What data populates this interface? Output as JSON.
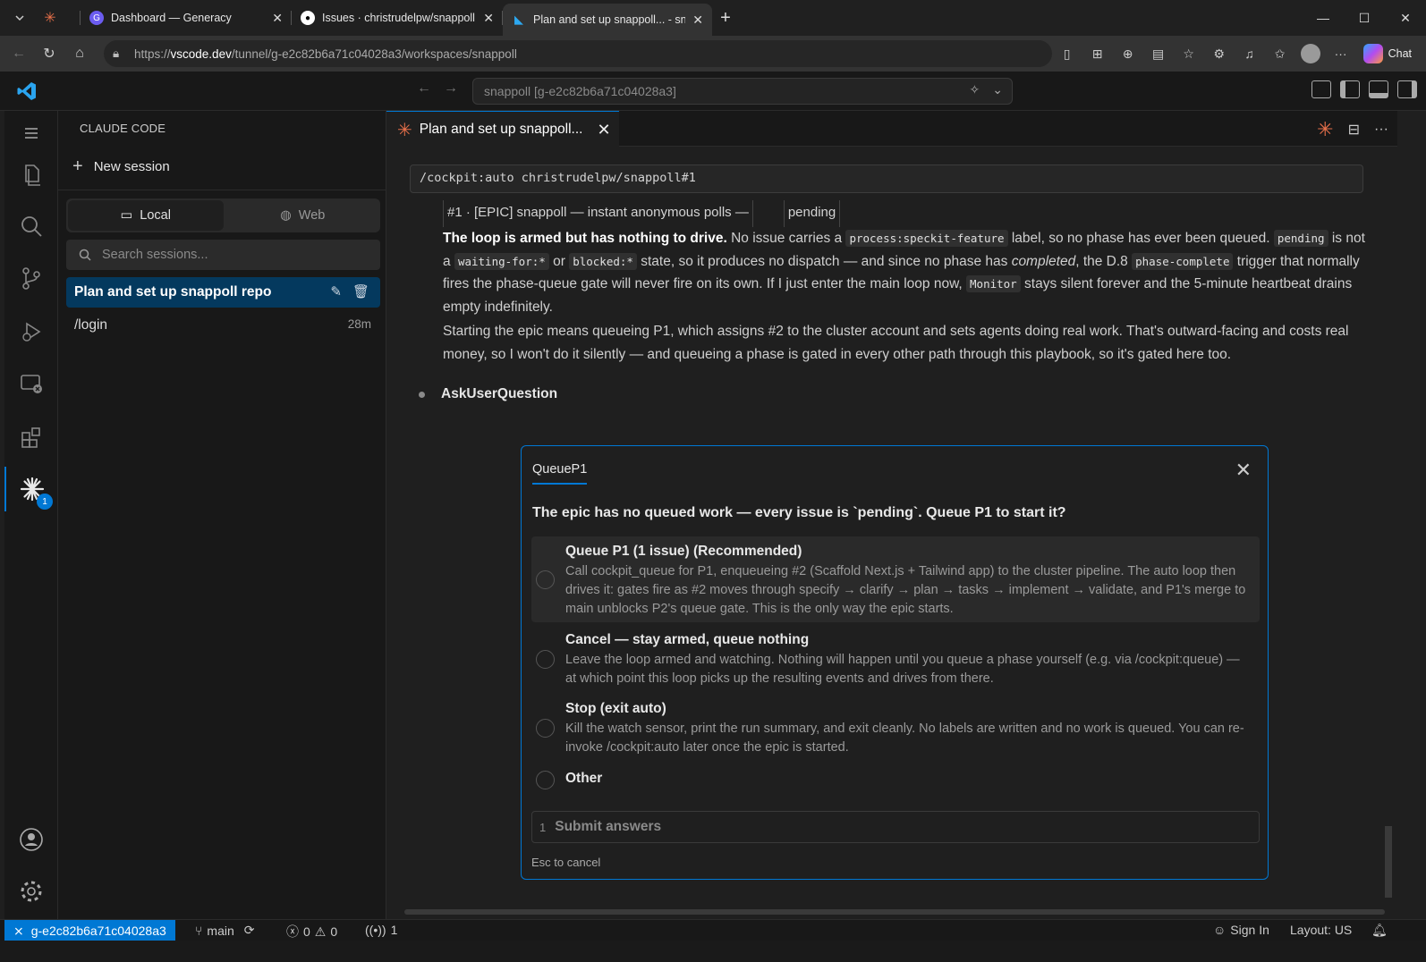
{
  "browser": {
    "tabs": [
      {
        "title": "",
        "favicon": "claude-asterisk-icon"
      },
      {
        "title": "Dashboard — Generacy",
        "favicon": "generacy-icon"
      },
      {
        "title": "Issues · christrudelpw/snappoll",
        "favicon": "github-icon"
      },
      {
        "title": "Plan and set up snappoll... - snapp",
        "favicon": "vscode-icon",
        "active": true
      }
    ],
    "url_host": "vscode.dev",
    "url_prefix": "https://",
    "url_path": "/tunnel/g-e2c82b6a71c04028a3/workspaces/snappoll",
    "chat_label": "Chat"
  },
  "titlebar": {
    "command_center": "snappoll [g-e2c82b6a71c04028a3]"
  },
  "sidebar": {
    "title": "CLAUDE CODE",
    "new_session": "New session",
    "segments": [
      {
        "label": "Local",
        "active": true
      },
      {
        "label": "Web",
        "active": false
      }
    ],
    "search_placeholder": "Search sessions...",
    "sessions": [
      {
        "label": "Plan and set up snappoll repo",
        "active": true
      },
      {
        "label": "/login",
        "time": "28m"
      }
    ]
  },
  "activity": {
    "badge": "1"
  },
  "editor": {
    "tab_title": "Plan and set up snappoll...",
    "command": "/cockpit:auto christrudelpw/snappoll#1",
    "issue_cells": [
      "#1 · [EPIC] snappoll — instant anonymous polls —",
      "pending"
    ],
    "msg": {
      "p1_bold": "The loop is armed but has nothing to drive.",
      "p1_a": " No issue carries a ",
      "p1_code1": "process:speckit-feature",
      "p1_b": " label, so no phase has ever been queued. ",
      "p1_code2": "pending",
      "p1_c": " is not a ",
      "p1_code3": "waiting-for:*",
      "p1_d": " or ",
      "p1_code4": "blocked:*",
      "p1_e": " state, so it produces no dispatch — and since no phase has ",
      "p1_em": "completed",
      "p1_f": ", the D.8 ",
      "p1_code5": "phase-complete",
      "p1_g": " trigger that normally fires the phase-queue gate will never fire on its own. If I just enter the main loop now, ",
      "p1_code6": "Monitor",
      "p1_h": " stays silent forever and the 5-minute heartbeat drains empty indefinitely.",
      "p2": "Starting the epic means queueing P1, which assigns #2 to the cluster account and sets agents doing real work. That's outward-facing and costs real money, so I won't do it silently — and queueing a phase is gated in every other path through this playbook, so it's gated here too."
    },
    "tool_name": "AskUserQuestion"
  },
  "question": {
    "tab": "QueueP1",
    "text": "The epic has no queued work — every issue is `pending`. Queue P1 to start it?",
    "options": [
      {
        "label": "Queue P1 (1 issue) (Recommended)",
        "desc": "Call cockpit_queue for P1, enqueueing #2 (Scaffold Next.js + Tailwind app) to the cluster pipeline. The auto loop then drives it: gates fire as #2 moves through specify → clarify → plan → tasks → implement → validate, and P1's merge to main unblocks P2's queue gate. This is the only way the epic starts."
      },
      {
        "label": "Cancel — stay armed, queue nothing",
        "desc": "Leave the loop armed and watching. Nothing will happen until you queue a phase yourself (e.g. via /cockpit:queue) — at which point this loop picks up the resulting events and drives from there."
      },
      {
        "label": "Stop (exit auto)",
        "desc": "Kill the watch sensor, print the run summary, and exit cleanly. No labels are written and no work is queued. You can re-invoke /cockpit:auto later once the epic is started."
      },
      {
        "label": "Other",
        "desc": ""
      }
    ],
    "submit_num": "1",
    "submit": "Submit answers",
    "esc_hint": "Esc to cancel"
  },
  "statusbar": {
    "remote": "g-e2c82b6a71c04028a3",
    "branch": "main",
    "errors": "0",
    "warnings": "0",
    "ports": "1",
    "sign_in": "Sign In",
    "layout": "Layout: US"
  },
  "colors": {
    "accent": "#0078d4",
    "claude": "#e8704a"
  }
}
